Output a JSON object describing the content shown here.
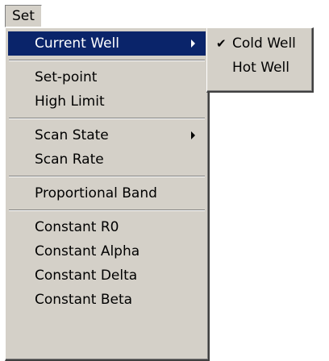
{
  "menubar": {
    "set_label": "Set"
  },
  "main_menu": {
    "items": [
      {
        "label": "Current Well"
      },
      {
        "label": "Set-point"
      },
      {
        "label": "High Limit"
      },
      {
        "label": "Scan State"
      },
      {
        "label": "Scan Rate"
      },
      {
        "label": "Proportional Band"
      },
      {
        "label": "Constant R0"
      },
      {
        "label": "Constant Alpha"
      },
      {
        "label": "Constant Delta"
      },
      {
        "label": "Constant Beta"
      }
    ]
  },
  "sub_menu": {
    "items": [
      {
        "label": "Cold Well",
        "checked": true
      },
      {
        "label": "Hot Well",
        "checked": false
      }
    ],
    "check_glyph": "✔"
  },
  "colors": {
    "menu_face": "#d4d0c8",
    "highlight": "#0a246a",
    "highlight_text": "#ffffff"
  }
}
